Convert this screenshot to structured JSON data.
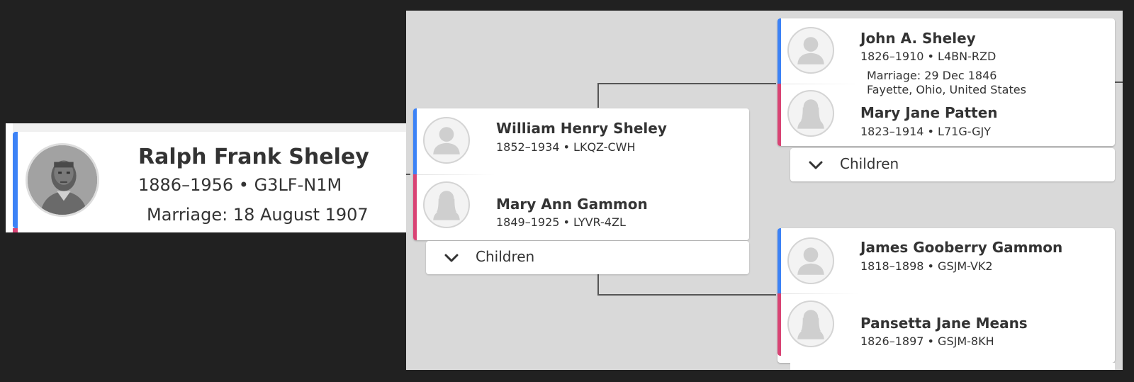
{
  "zoom": {
    "name": "Ralph Frank Sheley",
    "dates": "1886–1956 • G3LF-N1M",
    "marriage": "Marriage: 18 August 1907"
  },
  "parents": {
    "father": {
      "name": "William Henry Sheley",
      "dates": "1852–1934 • LKQZ-CWH"
    },
    "mother": {
      "name": "Mary Ann Gammon",
      "dates": "1849–1925 • LYVR-4ZL"
    },
    "children_label": "Children"
  },
  "paternal": {
    "father": {
      "name": "John A. Sheley",
      "dates": "1826–1910 • L4BN-RZD"
    },
    "marriage_line1": "Marriage: 29 Dec 1846",
    "marriage_line2": "Fayette, Ohio, United States",
    "mother": {
      "name": "Mary Jane Patten",
      "dates": "1823–1914 • L71G-GJY"
    },
    "children_label": "Children"
  },
  "maternal": {
    "father": {
      "name": "James Gooberry Gammon",
      "dates": "1818–1898 • GSJM-VK2"
    },
    "mother": {
      "name": "Pansetta Jane Means",
      "dates": "1826–1897 • GSJM-8KH"
    }
  },
  "colors": {
    "male": "#3c82f6",
    "female": "#d94374",
    "background": "#212121",
    "panel": "#d9d9d9"
  },
  "icons": [
    "person-silhouette-icon",
    "chevron-down-icon"
  ]
}
